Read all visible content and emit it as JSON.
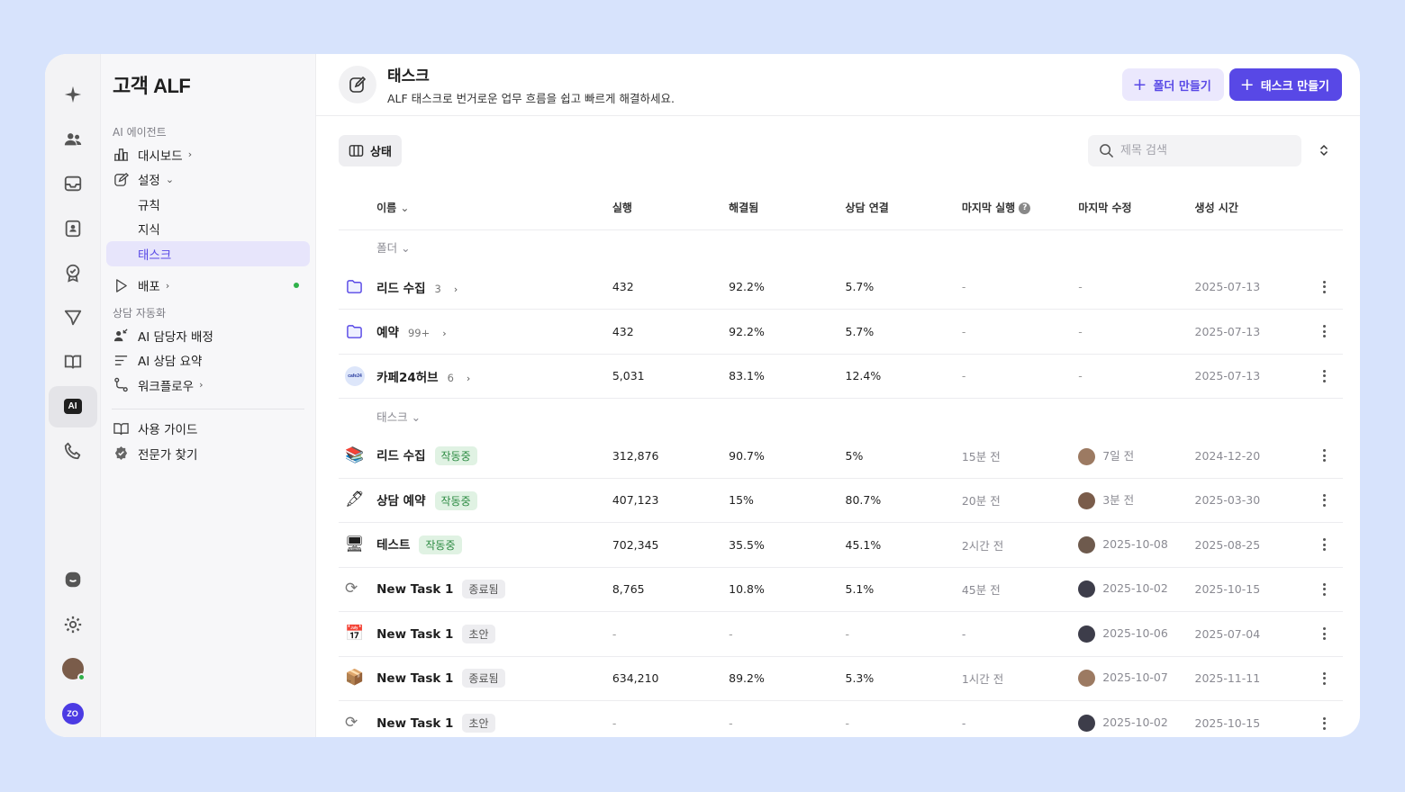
{
  "sidebar": {
    "brand": "고객 ALF",
    "section_ai": "AI 에이전트",
    "dashboard": "대시보드",
    "settings": "설정",
    "rules": "규칙",
    "knowledge": "지식",
    "tasks": "태스크",
    "deploy": "배포",
    "section_auto": "상담 자동화",
    "ai_assign": "AI 담당자 배정",
    "ai_summary": "AI 상담 요약",
    "workflow": "워크플로우",
    "guide": "사용 가이드",
    "expert": "전문가 찾기"
  },
  "header": {
    "title": "태스크",
    "description": "ALF 태스크로 번거로운 업무 흐름을 쉽고 빠르게 해결하세요.",
    "new_folder": "폴더 만들기",
    "new_task": "태스크 만들기"
  },
  "toolbar": {
    "view_label": "상태",
    "search_placeholder": "제목 검색"
  },
  "table": {
    "columns": [
      "이름",
      "실행",
      "해결됨",
      "상담 연결",
      "마지막 실행",
      "마지막 수정",
      "생성 시간"
    ],
    "folder_group": "폴더",
    "task_group": "태스크",
    "folders": [
      {
        "name": "리드 수집",
        "count": "3",
        "run": "432",
        "resolved": "92.2%",
        "connect": "5.7%",
        "last_run": "-",
        "last_mod": "-",
        "created": "2025-07-13"
      },
      {
        "name": "예약",
        "count": "99+",
        "run": "432",
        "resolved": "92.2%",
        "connect": "5.7%",
        "last_run": "-",
        "last_mod": "-",
        "created": "2025-07-13"
      },
      {
        "name": "카페24허브",
        "count": "6",
        "logo": "cafe24",
        "run": "5,031",
        "resolved": "83.1%",
        "connect": "12.4%",
        "last_run": "-",
        "last_mod": "-",
        "created": "2025-07-13"
      }
    ],
    "tasks": [
      {
        "icon": "📚",
        "name": "리드 수집",
        "status": "작동중",
        "active": true,
        "run": "312,876",
        "resolved": "90.7%",
        "connect": "5%",
        "last_run": "15분 전",
        "last_mod": "7일 전",
        "created": "2024-12-20"
      },
      {
        "icon": "🖋",
        "name": "상담 예약",
        "status": "작동중",
        "active": true,
        "run": "407,123",
        "resolved": "15%",
        "connect": "80.7%",
        "last_run": "20분 전",
        "last_mod": "3분 전",
        "created": "2025-03-30"
      },
      {
        "icon": "🖥",
        "name": "테스트",
        "status": "작동중",
        "active": true,
        "run": "702,345",
        "resolved": "35.5%",
        "connect": "45.1%",
        "last_run": "2시간 전",
        "last_mod": "2025-10-08",
        "created": "2025-08-25"
      },
      {
        "icon": "⟳",
        "name": "New Task 1",
        "status": "종료됨",
        "active": false,
        "run": "8,765",
        "resolved": "10.8%",
        "connect": "5.1%",
        "last_run": "45분 전",
        "last_mod": "2025-10-02",
        "created": "2025-10-15"
      },
      {
        "icon": "📅",
        "name": "New Task 1",
        "status": "초안",
        "active": false,
        "run": "-",
        "resolved": "-",
        "connect": "-",
        "last_run": "-",
        "last_mod": "2025-10-06",
        "created": "2025-07-04"
      },
      {
        "icon": "📦",
        "name": "New Task 1",
        "status": "종료됨",
        "active": false,
        "run": "634,210",
        "resolved": "89.2%",
        "connect": "5.3%",
        "last_run": "1시간 전",
        "last_mod": "2025-10-07",
        "created": "2025-11-11"
      },
      {
        "icon": "⟳",
        "name": "New Task 1",
        "status": "초안",
        "active": false,
        "run": "-",
        "resolved": "-",
        "connect": "-",
        "last_run": "-",
        "last_mod": "2025-10-02",
        "created": "2025-10-15"
      }
    ]
  },
  "rail": {
    "ai_badge": "AI",
    "zo": "ZO"
  },
  "colors": {
    "accent": "#5848e6",
    "accent_soft": "#ebe8fd",
    "active_green": "#2fb14a"
  }
}
